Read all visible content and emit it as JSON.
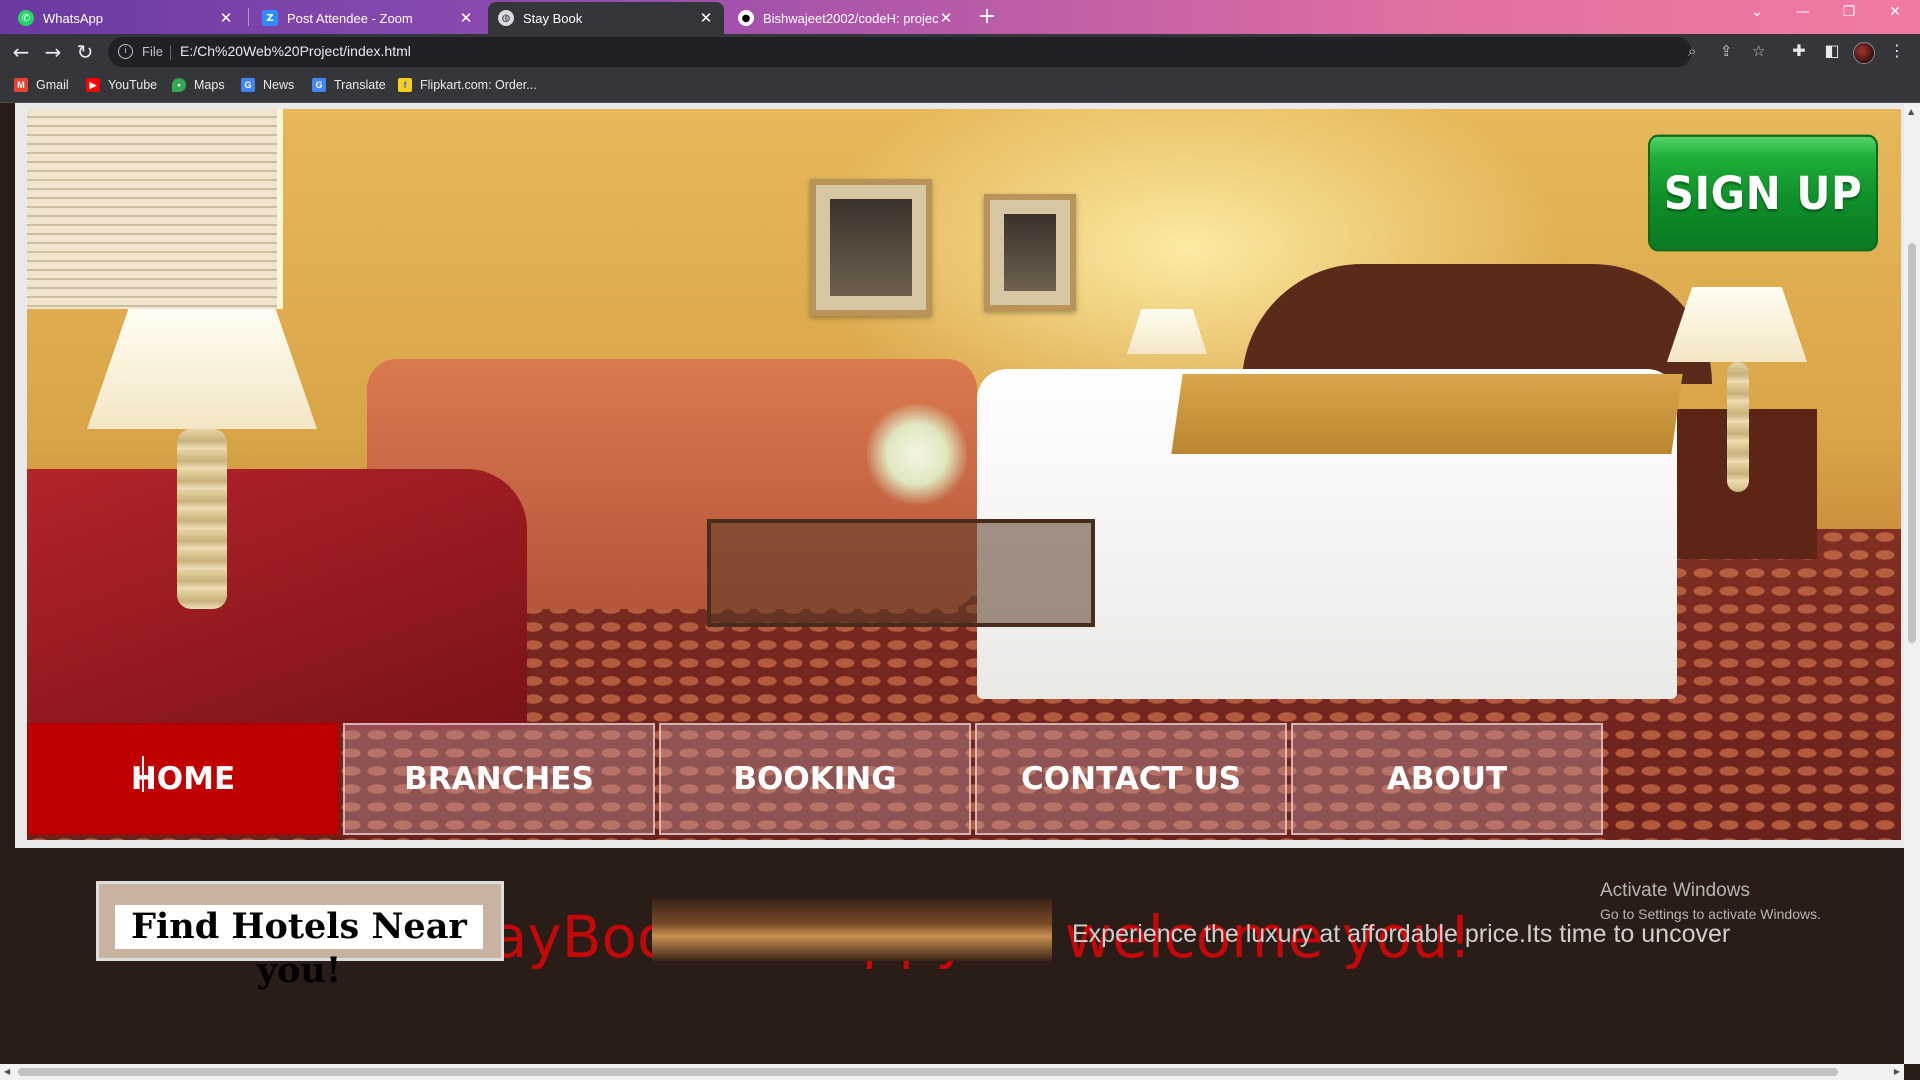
{
  "browser": {
    "tabs": [
      {
        "title": "WhatsApp",
        "icon": "whatsapp-icon"
      },
      {
        "title": "Post Attendee - Zoom",
        "icon": "zoom-icon"
      },
      {
        "title": "Stay Book",
        "icon": "globe-icon"
      },
      {
        "title": "Bishwajeet2002/codeH: project",
        "icon": "github-icon"
      }
    ],
    "active_tab": 2,
    "address": {
      "protocol": "File",
      "url": "E:/Ch%20Web%20Project/index.html"
    },
    "bookmarks": [
      {
        "label": "Gmail",
        "icon": "gmail-icon",
        "color": "#ea4335"
      },
      {
        "label": "YouTube",
        "icon": "youtube-icon",
        "color": "#ff0000"
      },
      {
        "label": "Maps",
        "icon": "maps-icon",
        "color": "#34a853"
      },
      {
        "label": "News",
        "icon": "news-icon",
        "color": "#4285f4"
      },
      {
        "label": "Translate",
        "icon": "translate-icon",
        "color": "#4285f4"
      },
      {
        "label": "Flipkart.com: Order...",
        "icon": "flipkart-icon",
        "color": "#f7d117"
      }
    ]
  },
  "page": {
    "signup_label": "SIGN UP",
    "nav": [
      "HOME",
      "BRANCHES",
      "BOOKING",
      "CONTACT US",
      "ABOUT"
    ],
    "active_nav": "HOME",
    "welcome": "StayBook is happy to welcome you!",
    "find_hotels": "Find Hotels Near you!",
    "description": "Experience the luxury at affordable price.Its time to uncover"
  },
  "os_overlay": {
    "line1": "Activate Windows",
    "line2": "Go to Settings to activate Windows."
  },
  "colors": {
    "accent_red": "#c4080a",
    "active_nav": "#c00000",
    "signup_green": "#0f8f2a",
    "page_bg": "#2a1c17"
  }
}
